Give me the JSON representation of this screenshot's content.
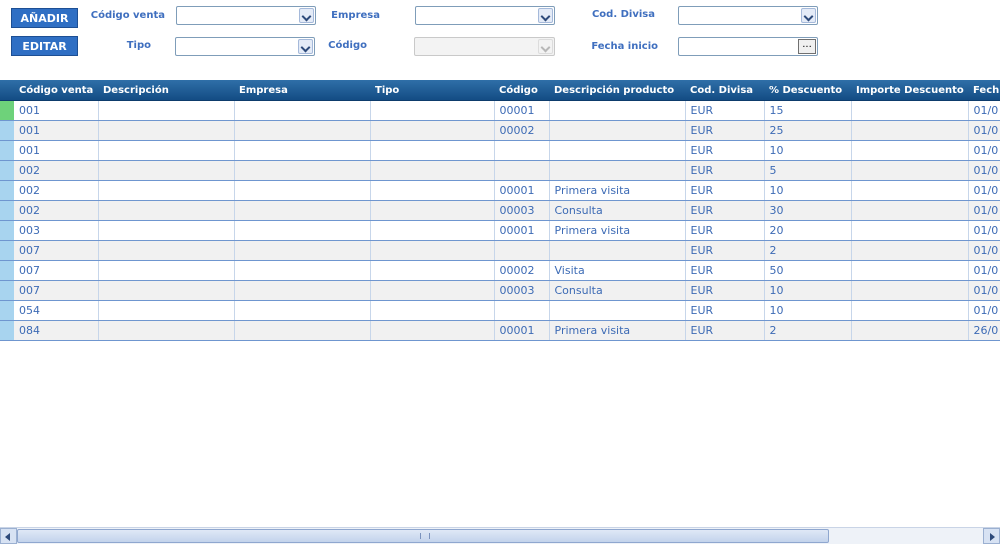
{
  "toolbar": {
    "add_label": "AÑADIR",
    "edit_label": "EDITAR"
  },
  "filters": {
    "codigo_venta_label": "Código venta",
    "empresa_label": "Empresa",
    "cod_divisa_label": "Cod. Divisa",
    "tipo_label": "Tipo",
    "codigo_label": "Código",
    "fecha_inicio_label": "Fecha inicio",
    "date_button_label": "..."
  },
  "grid": {
    "columns": [
      "Código venta",
      "Descripción",
      "Empresa",
      "Tipo",
      "Código",
      "Descripción producto",
      "Cod. Divisa",
      "% Descuento",
      "Importe Descuento",
      "Fech"
    ],
    "rows": [
      {
        "codigo_venta": "001",
        "descripcion": "",
        "empresa": "",
        "tipo": "",
        "codigo": "00001",
        "desc_producto": "",
        "divisa": "EUR",
        "descuento": "15",
        "importe": "",
        "fecha": "01/0"
      },
      {
        "codigo_venta": "001",
        "descripcion": "",
        "empresa": "",
        "tipo": "",
        "codigo": "00002",
        "desc_producto": "",
        "divisa": "EUR",
        "descuento": "25",
        "importe": "",
        "fecha": "01/0"
      },
      {
        "codigo_venta": "001",
        "descripcion": "",
        "empresa": "",
        "tipo": "",
        "codigo": "",
        "desc_producto": "",
        "divisa": "EUR",
        "descuento": "10",
        "importe": "",
        "fecha": "01/0"
      },
      {
        "codigo_venta": "002",
        "descripcion": "",
        "empresa": "",
        "tipo": "",
        "codigo": "",
        "desc_producto": "",
        "divisa": "EUR",
        "descuento": "5",
        "importe": "",
        "fecha": "01/0"
      },
      {
        "codigo_venta": "002",
        "descripcion": "",
        "empresa": "",
        "tipo": "",
        "codigo": "00001",
        "desc_producto": "Primera visita",
        "divisa": "EUR",
        "descuento": "10",
        "importe": "",
        "fecha": "01/0"
      },
      {
        "codigo_venta": "002",
        "descripcion": "",
        "empresa": "",
        "tipo": "",
        "codigo": "00003",
        "desc_producto": "Consulta",
        "divisa": "EUR",
        "descuento": "30",
        "importe": "",
        "fecha": "01/0"
      },
      {
        "codigo_venta": "003",
        "descripcion": "",
        "empresa": "",
        "tipo": "",
        "codigo": "00001",
        "desc_producto": "Primera visita",
        "divisa": "EUR",
        "descuento": "20",
        "importe": "",
        "fecha": "01/0"
      },
      {
        "codigo_venta": "007",
        "descripcion": "",
        "empresa": "",
        "tipo": "",
        "codigo": "",
        "desc_producto": "",
        "divisa": "EUR",
        "descuento": "2",
        "importe": "",
        "fecha": "01/0"
      },
      {
        "codigo_venta": "007",
        "descripcion": "",
        "empresa": "",
        "tipo": "",
        "codigo": "00002",
        "desc_producto": "Visita",
        "divisa": "EUR",
        "descuento": "50",
        "importe": "",
        "fecha": "01/0"
      },
      {
        "codigo_venta": "007",
        "descripcion": "",
        "empresa": "",
        "tipo": "",
        "codigo": "00003",
        "desc_producto": "Consulta",
        "divisa": "EUR",
        "descuento": "10",
        "importe": "",
        "fecha": "01/0"
      },
      {
        "codigo_venta": "054",
        "descripcion": "",
        "empresa": "",
        "tipo": "",
        "codigo": "",
        "desc_producto": "",
        "divisa": "EUR",
        "descuento": "10",
        "importe": "",
        "fecha": "01/0"
      },
      {
        "codigo_venta": "084",
        "descripcion": "",
        "empresa": "",
        "tipo": "",
        "codigo": "00001",
        "desc_producto": "Primera visita",
        "divisa": "EUR",
        "descuento": "2",
        "importe": "",
        "fecha": "26/0"
      }
    ]
  },
  "scrollbar": {
    "grip_icon": "scroll-grip-icon"
  }
}
